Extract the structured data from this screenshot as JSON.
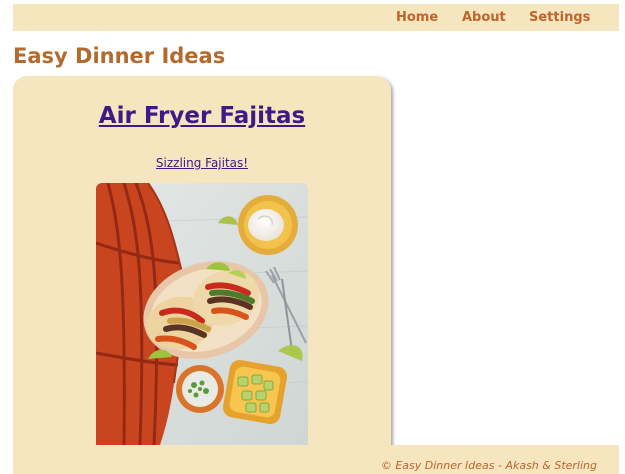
{
  "nav": {
    "items": [
      {
        "label": "Home"
      },
      {
        "label": "About"
      },
      {
        "label": "Settings"
      }
    ]
  },
  "page": {
    "title": "Easy Dinner Ideas"
  },
  "recipe": {
    "title": "Air Fryer Fajitas",
    "link_text": "Sizzling Fajitas!"
  },
  "footer": {
    "text": "© Easy Dinner Ideas - Akash & Sterling"
  },
  "colors": {
    "nav_background": "#f5e6c0",
    "nav_link": "#c0642a",
    "heading": "#b26a2e",
    "link": "#3d1a84",
    "card_background": "#f5e6c0"
  }
}
